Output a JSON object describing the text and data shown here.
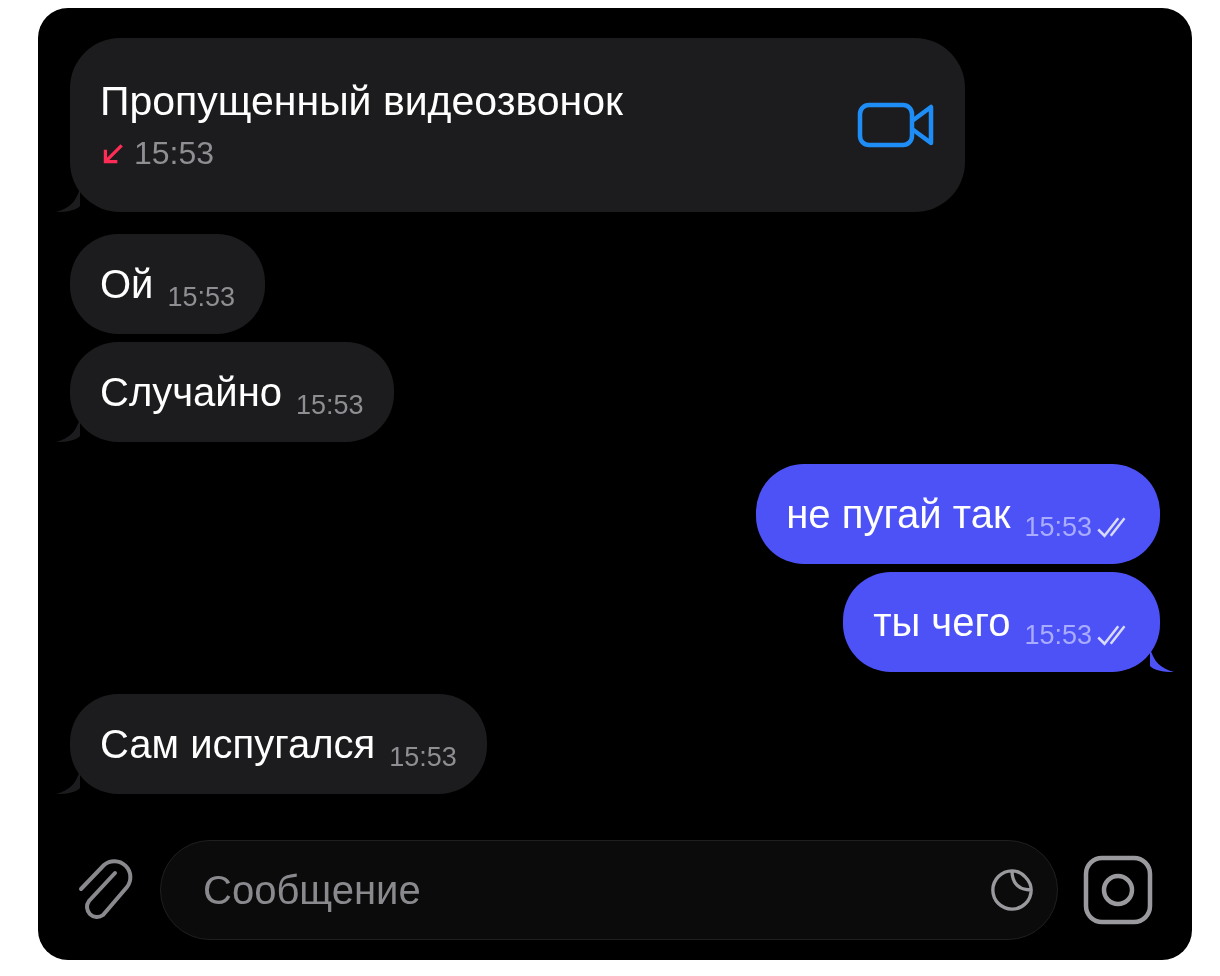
{
  "messages": [
    {
      "kind": "call",
      "outgoing": false,
      "tail": true,
      "text": "Пропущенный видеозвонок",
      "time": "15:53",
      "missed": true
    },
    {
      "kind": "text",
      "outgoing": false,
      "tail": false,
      "text": "Ой",
      "time": "15:53"
    },
    {
      "kind": "text",
      "outgoing": false,
      "tail": true,
      "text": "Случайно",
      "time": "15:53"
    },
    {
      "kind": "text",
      "outgoing": true,
      "tail": false,
      "text": "не пугай так",
      "time": "15:53",
      "read": true
    },
    {
      "kind": "text",
      "outgoing": true,
      "tail": true,
      "text": "ты чего",
      "time": "15:53",
      "read": true
    },
    {
      "kind": "text",
      "outgoing": false,
      "tail": true,
      "text": "Сам испугался",
      "time": "15:53"
    }
  ],
  "composer": {
    "placeholder": "Сообщение"
  }
}
